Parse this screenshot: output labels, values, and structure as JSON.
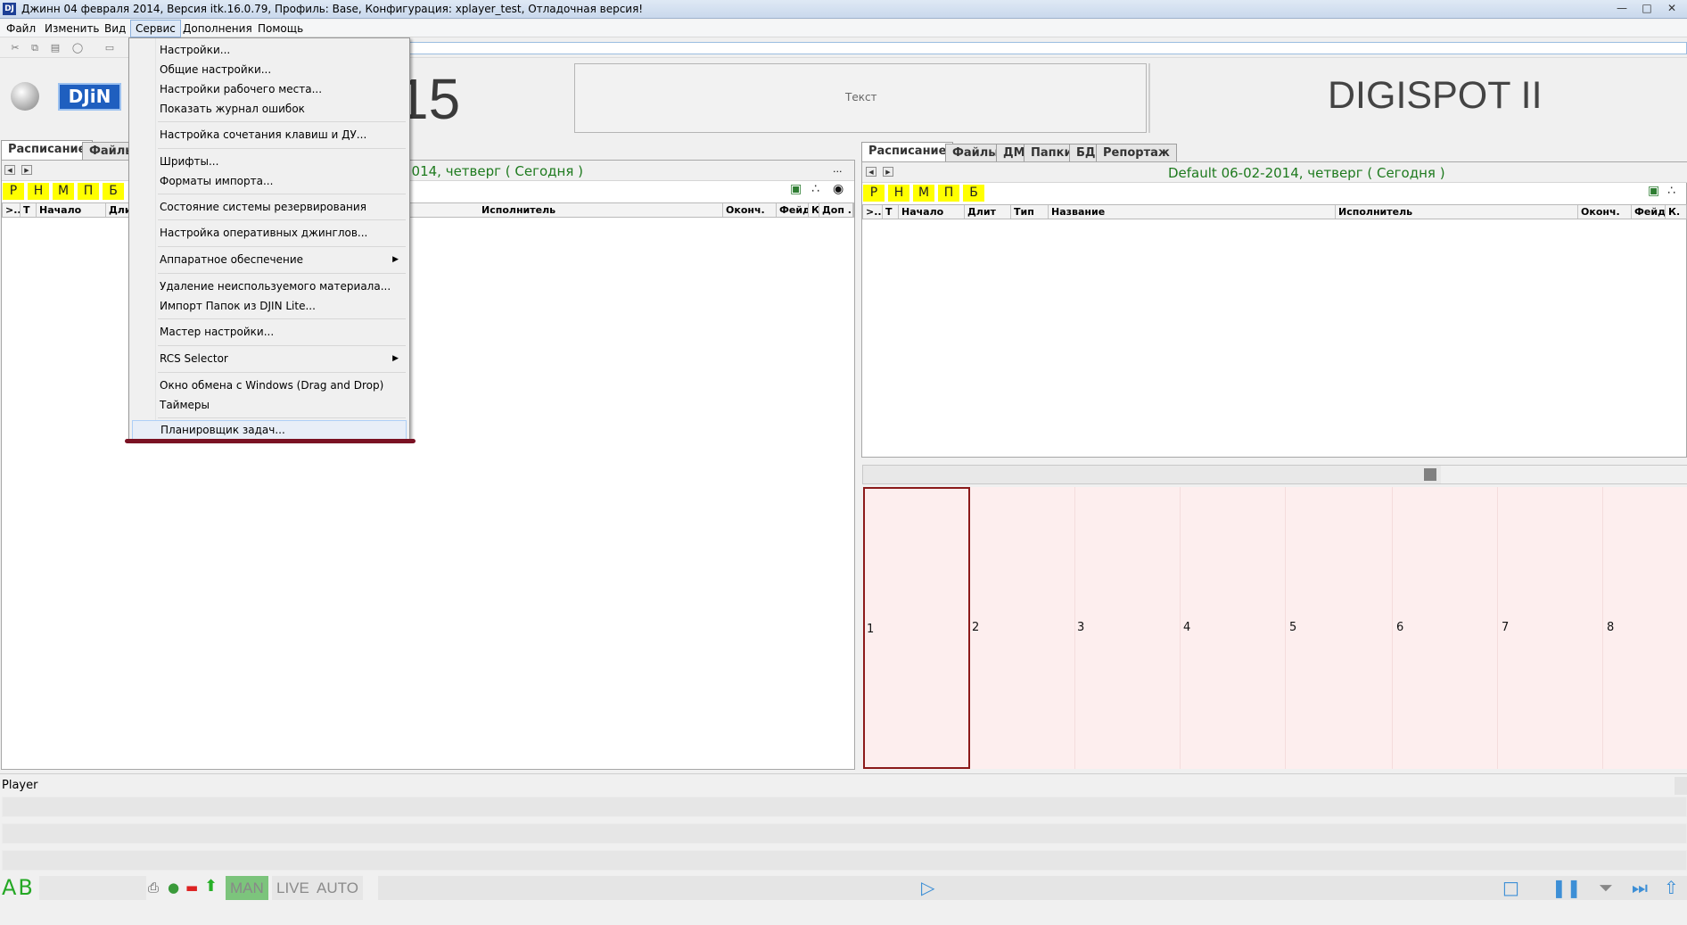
{
  "window": {
    "title": "Джинн 04 февраля 2014, Версия itk.16.0.79, Профиль: Base, Конфигурация: xplayer_test, Отладочная версия!",
    "icon_text": "DJ"
  },
  "menubar": {
    "items": [
      {
        "label": "Файл"
      },
      {
        "label": "Изменить"
      },
      {
        "label": "Вид"
      },
      {
        "label": "Сервис"
      },
      {
        "label": "Дополнения"
      },
      {
        "label": "Помощь"
      }
    ]
  },
  "service_menu": {
    "items": [
      {
        "label": "Настройки..."
      },
      {
        "label": "Общие настройки..."
      },
      {
        "label": "Настройки рабочего места..."
      },
      {
        "label": "Показать журнал ошибок"
      },
      {
        "label": "Настройка сочетания клавиш и ДУ..."
      },
      {
        "label": "Шрифты..."
      },
      {
        "label": "Форматы импорта..."
      },
      {
        "label": "Состояние системы резервирования"
      },
      {
        "label": "Настройка оперативных джинглов..."
      },
      {
        "label": "Аппаратное обеспечение"
      },
      {
        "label": "Удаление неиспользуемого материала..."
      },
      {
        "label": "Импорт Папок из DJIN Lite..."
      },
      {
        "label": "Мастер настройки..."
      },
      {
        "label": "RCS Selector"
      },
      {
        "label": "Окно обмена с Windows (Drag and Drop)"
      },
      {
        "label": "Таймеры"
      },
      {
        "label": "Планировщик задач..."
      }
    ]
  },
  "header": {
    "logo_text": "DJiN",
    "clock_fragment": "15",
    "text_box_label": "Текст",
    "brand": "DIGISPOT II"
  },
  "left_panel": {
    "tabs": [
      {
        "label": "Расписание"
      },
      {
        "label": "Файлы"
      }
    ],
    "date_fragment": "2014, четверг ( Сегодня )",
    "ellipsis": "...",
    "quick_buttons": [
      "Р",
      "Н",
      "М",
      "П",
      "Б"
    ],
    "columns": [
      {
        "label": ">..."
      },
      {
        "label": "Т"
      },
      {
        "label": "Начало"
      },
      {
        "label": "Длит"
      },
      {
        "label": "Исполнитель"
      },
      {
        "label": "Оконч."
      },
      {
        "label": "Фейд"
      },
      {
        "label": "К."
      },
      {
        "label": "Доп ..."
      }
    ]
  },
  "right_panel": {
    "tabs": [
      {
        "label": "Расписание"
      },
      {
        "label": "Файлы"
      },
      {
        "label": "ДМ"
      },
      {
        "label": "Папки"
      },
      {
        "label": "БД"
      },
      {
        "label": "Репортаж"
      }
    ],
    "date": "Default 06-02-2014, четверг ( Сегодня )",
    "quick_buttons": [
      "Р",
      "Н",
      "М",
      "П",
      "Б"
    ],
    "columns": [
      {
        "label": ">..."
      },
      {
        "label": "Т"
      },
      {
        "label": "Начало"
      },
      {
        "label": "Длит"
      },
      {
        "label": "Тип"
      },
      {
        "label": "Название"
      },
      {
        "label": "Исполнитель"
      },
      {
        "label": "Оконч."
      },
      {
        "label": "Фейд"
      },
      {
        "label": "К."
      }
    ]
  },
  "cart": {
    "cells": [
      "1",
      "2",
      "3",
      "4",
      "5",
      "6",
      "7",
      "8"
    ],
    "selected_index": 0
  },
  "player": {
    "label": "Player"
  },
  "status": {
    "ab_label": "AB",
    "modes": [
      {
        "label": "MAN",
        "active": true
      },
      {
        "label": "LIVE",
        "active": false
      },
      {
        "label": "AUTO",
        "active": false
      }
    ]
  },
  "icons": {
    "toolbar": [
      "cut-icon",
      "copy-icon",
      "paste-icon",
      "find-icon",
      "page-icon",
      "page2-icon"
    ],
    "transport": [
      "play-icon",
      "stop-icon",
      "pause-icon",
      "eject-icon",
      "skip-icon",
      "up-icon"
    ]
  },
  "colors": {
    "accent_green": "#1e7a1e",
    "quick_button_yellow": "#ffff00",
    "cart_bg": "#fdeeee",
    "cart_selected_border": "#8b1a1a",
    "highlight_underline": "#7a1123"
  }
}
